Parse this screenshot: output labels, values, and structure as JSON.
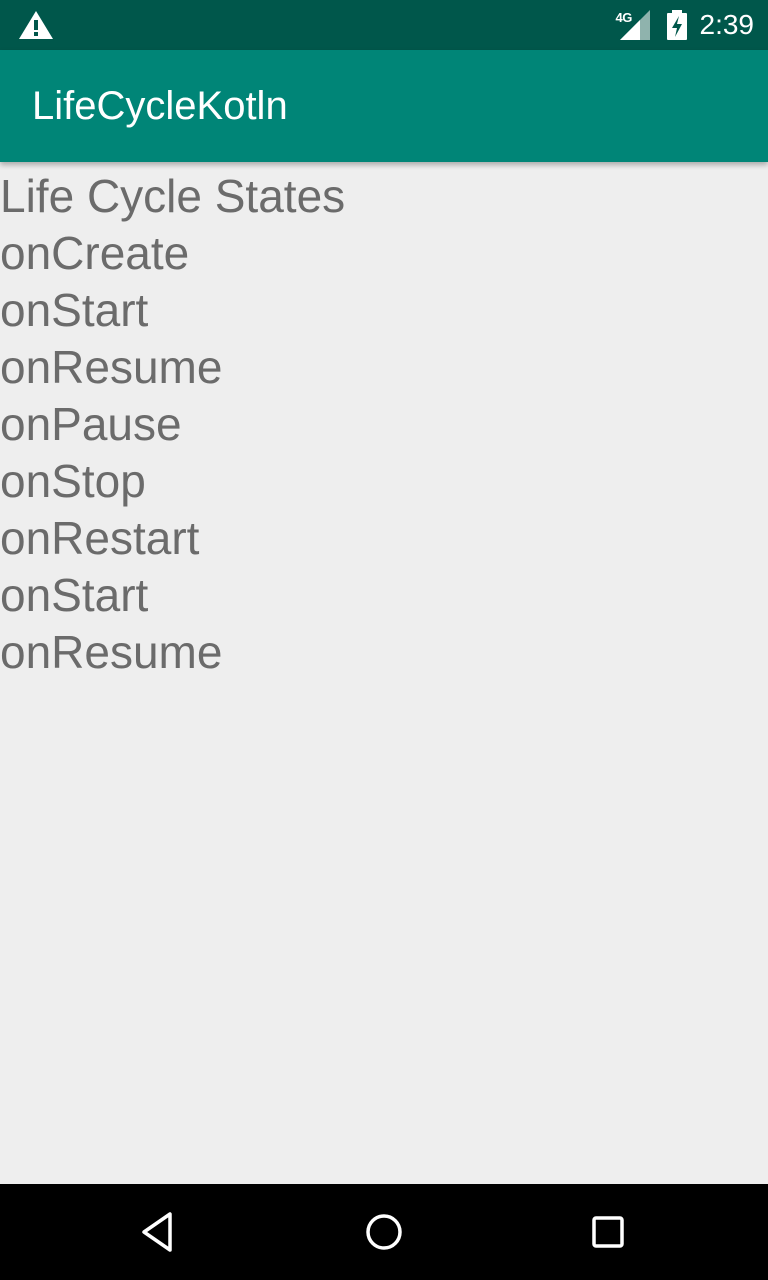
{
  "status_bar": {
    "time": "2:39",
    "network_label": "4G",
    "icons": [
      "warning-icon",
      "signal-icon",
      "battery-charging-icon"
    ],
    "background_color": "#00574B"
  },
  "app_bar": {
    "title": "LifeCycleKotln",
    "background_color": "#008577"
  },
  "content": {
    "header": "Life Cycle States",
    "states": [
      "onCreate",
      "onStart",
      "onResume",
      "onPause",
      "onStop",
      "onRestart",
      "onStart",
      "onResume"
    ],
    "text_color": "#6B6B6B",
    "background_color": "#EEEEEE"
  },
  "nav_bar": {
    "buttons": [
      "back-icon",
      "home-icon",
      "recents-icon"
    ]
  }
}
